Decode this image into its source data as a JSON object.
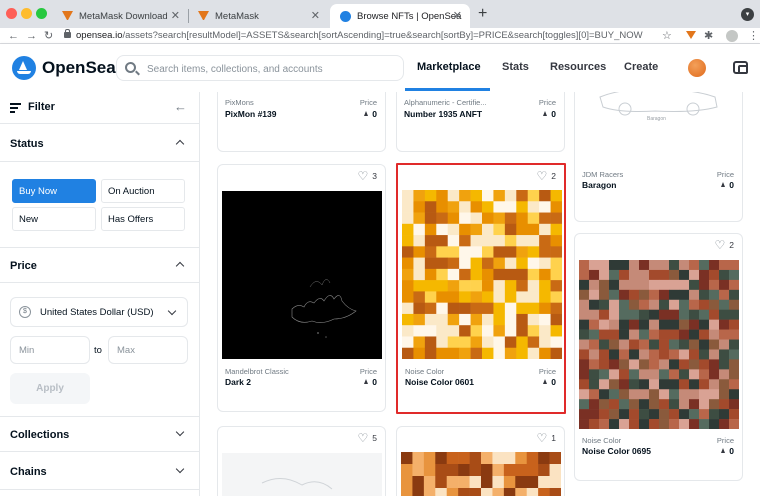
{
  "browser": {
    "tabs": [
      {
        "title": "MetaMask Download",
        "close": "✕"
      },
      {
        "title": "MetaMask",
        "close": "✕"
      },
      {
        "title": "Browse NFTs | OpenSea",
        "close": "✕"
      }
    ],
    "new_tab": "+",
    "url_host": "opensea.io",
    "url_path": "/assets?search[resultModel]=ASSETS&search[sortAscending]=true&search[sortBy]=PRICE&search[toggles][0]=BUY_NOW"
  },
  "header": {
    "brand": "OpenSea",
    "search_placeholder": "Search items, collections, and accounts",
    "nav": [
      "Marketplace",
      "Stats",
      "Resources",
      "Create"
    ]
  },
  "sidebar": {
    "filter_title": "Filter",
    "status": {
      "label": "Status",
      "buttons": [
        "Buy Now",
        "On Auction",
        "New",
        "Has Offers"
      ],
      "selected": "Buy Now"
    },
    "price": {
      "label": "Price",
      "currency": "United States Dollar (USD)",
      "min_placeholder": "Min",
      "to": "to",
      "max_placeholder": "Max",
      "apply": "Apply"
    },
    "collections_label": "Collections",
    "chains_label": "Chains"
  },
  "cards": [
    {
      "collection": "PixMons",
      "name": "PixMon #139",
      "price_label": "Price",
      "price": "0"
    },
    {
      "collection": "Alphanumeric - Certifie...",
      "name": "Number 1935 ANFT",
      "price_label": "Price",
      "price": "0"
    },
    {
      "collection": "JDM Racers",
      "name": "Baragon",
      "price_label": "Price",
      "price": "0",
      "art_caption": "Baragon"
    },
    {
      "collection": "Mandelbrot Classic",
      "name": "Dark 2",
      "price_label": "Price",
      "price": "0",
      "favorites": "3"
    },
    {
      "collection": "Noise Color",
      "name": "Noise Color 0601",
      "price_label": "Price",
      "price": "0",
      "favorites": "2"
    },
    {
      "collection": "Noise Color",
      "name": "Noise Color 0695",
      "price_label": "Price",
      "price": "0",
      "favorites": "2"
    },
    {
      "favorites": "5"
    },
    {
      "favorites": "1"
    }
  ],
  "colors": {
    "accent": "#2081e2",
    "highlight": "#e02a2a",
    "noise_orange": [
      "#f5b800",
      "#e88f00",
      "#c96a14",
      "#fbe9c8",
      "#f0a20e",
      "#b85a12",
      "#ffd24d",
      "#fff7ea"
    ],
    "noise_muted": [
      "#a34a2c",
      "#3d4d42",
      "#c58a78",
      "#7a3024",
      "#556b5f",
      "#d9a294",
      "#8a5a3c",
      "#2f3a36",
      "#b8664a"
    ],
    "noise_copper": [
      "#c8621c",
      "#e8943e",
      "#8a3a10",
      "#f4b06a",
      "#a84c16",
      "#fbe3c2"
    ]
  }
}
